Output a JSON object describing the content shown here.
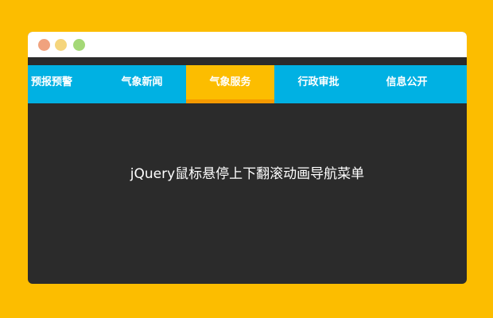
{
  "window": {
    "controls": [
      "close",
      "minimize",
      "maximize"
    ]
  },
  "nav": {
    "items": [
      {
        "label": "预报预警"
      },
      {
        "label": "气象新闻"
      },
      {
        "label": "气象服务"
      },
      {
        "label": "行政审批"
      },
      {
        "label": "信息公开"
      }
    ],
    "active_index": 2
  },
  "content": {
    "title": "jQuery鼠标悬停上下翻滚动画导航菜单"
  },
  "colors": {
    "background": "#fcbd00",
    "nav": "#00b1e3",
    "active": "#fcbd00",
    "panel": "#2b2b2b"
  }
}
